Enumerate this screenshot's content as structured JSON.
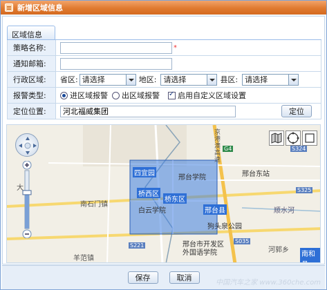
{
  "window": {
    "title": "新增区域信息"
  },
  "tab": {
    "label": "区域信息"
  },
  "form": {
    "policy_name": {
      "label": "策略名称:",
      "value": "",
      "required_mark": "*"
    },
    "notify_email": {
      "label": "通知邮箱:",
      "value": ""
    },
    "admin_region": {
      "label": "行政区域:",
      "province_label": "省区:",
      "province_value": "请选择",
      "city_label": "地区:",
      "city_value": "请选择",
      "county_label": "县区:",
      "county_value": "请选择"
    },
    "alarm_type": {
      "label": "报警类型:",
      "options": [
        "进区域报警",
        "出区域报警"
      ],
      "selected": "进区域报警",
      "custom_region_label": "启用自定义区域设置",
      "custom_region_checked": true
    },
    "location": {
      "label": "定位位置:",
      "value": "河北福威集团",
      "button": "定位"
    }
  },
  "map": {
    "labels": {
      "siyi": "四宜园",
      "xingtai_college": "邢台学院",
      "xingtai_east_station": "邢台东站",
      "qiaoxi": "桥西区",
      "qiaodong": "桥东区",
      "baiyun_temple": "白云学院",
      "xingtai_county": "邢台县",
      "nanshimen": "南石门镇",
      "goutou_park": "狗头泉公园",
      "xingtai_dev": "邢台市开发区",
      "foreign_lang": "外国语学院",
      "shunshui": "顺水河",
      "nanhe": "南和县",
      "yangfan": "羊范镇",
      "hedong": "河郭乡",
      "jinggang": "京港澳高速",
      "da": "大"
    },
    "road_badges": [
      "S324",
      "S325",
      "S221",
      "G4",
      "S035"
    ],
    "tools": [
      "map-icon",
      "circle-tool-icon",
      "rectangle-tool-icon"
    ],
    "zoom_level_fraction": 0.62,
    "region_color": "#3f7fe0"
  },
  "footer": {
    "save": "保存",
    "cancel": "取消"
  },
  "watermark": "中国汽车之家 www.360che.com"
}
